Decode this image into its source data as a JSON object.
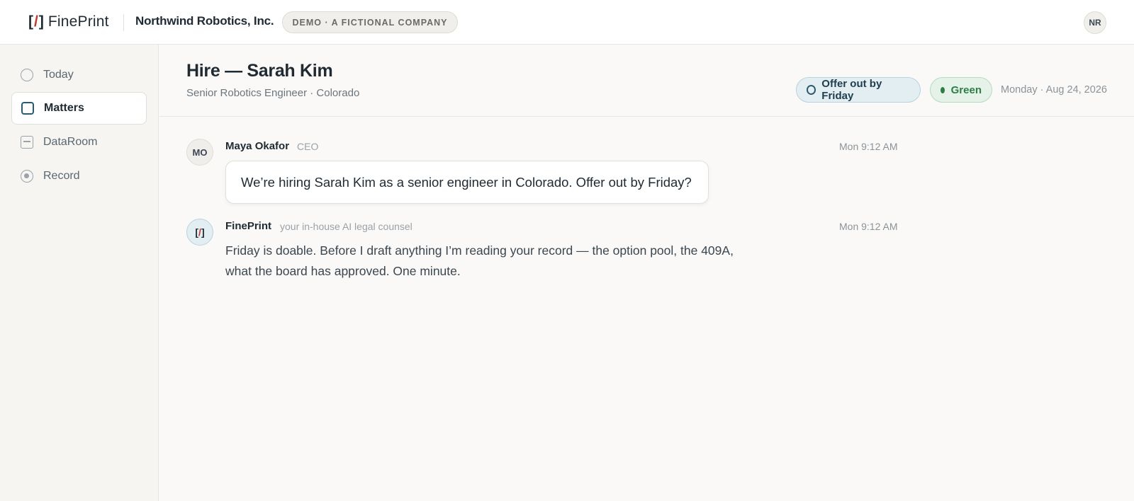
{
  "topbar": {
    "logo_left": "[",
    "logo_slash": "/",
    "logo_right": "]",
    "logo_word": "FinePrint",
    "company": "Northwind Robotics, Inc.",
    "demo_badge": "DEMO · A FICTIONAL COMPANY",
    "user_initials": "NR"
  },
  "sidebar": {
    "items": [
      {
        "label": "Today",
        "icon": "circle-icon",
        "active": false
      },
      {
        "label": "Matters",
        "icon": "square-icon",
        "active": true
      },
      {
        "label": "DataRoom",
        "icon": "box-icon",
        "active": false
      },
      {
        "label": "Record",
        "icon": "record-icon",
        "active": false
      }
    ]
  },
  "header": {
    "title": "Hire — Sarah Kim",
    "subtitle": "Senior Robotics Engineer · Colorado",
    "deadline_pill": "Offer out by Friday",
    "status_pill": "Green",
    "date": "Monday · Aug 24, 2026"
  },
  "messages": [
    {
      "initials": "MO",
      "sender": "Maya Okafor",
      "role": "CEO",
      "time": "Mon 9:12 AM",
      "text": "We’re hiring Sarah Kim as a senior engineer in Colorado. Offer out by Friday?"
    },
    {
      "initials_left": "[",
      "initials_slash": "/",
      "initials_right": "]",
      "sender": "FinePrint",
      "role": "your in-house AI legal counsel",
      "time": "Mon 9:12 AM",
      "text_line1": "Friday is doable. Before I draft anything I’m reading your record — the option pool, the 409A,",
      "text_line2": "what the board has approved. One minute."
    }
  ],
  "colors": {
    "accent": "#2b5a70",
    "logo_slash": "#c0392b",
    "status_green": "#2e7d48",
    "background": "#faf9f7"
  }
}
